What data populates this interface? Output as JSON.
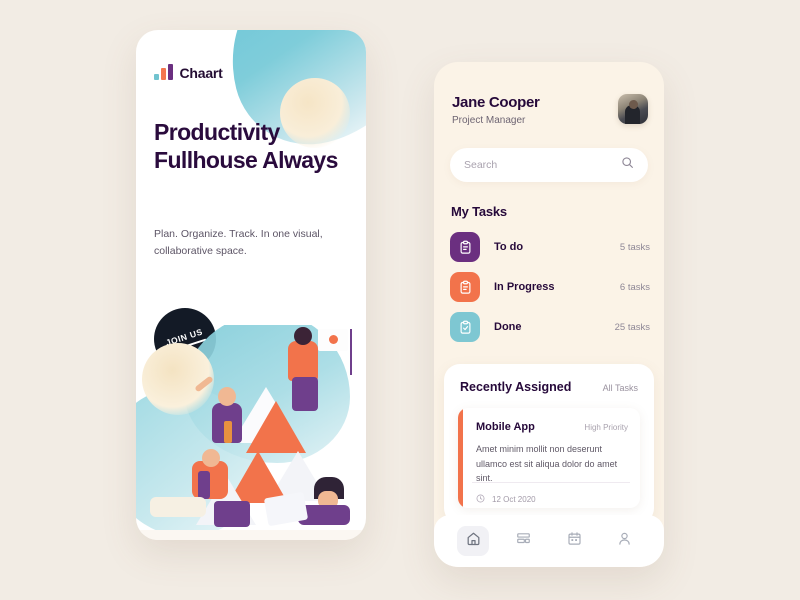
{
  "colors": {
    "background": "#f2ece4",
    "panel": "#fbf3e7",
    "heading": "#2a0b3d",
    "accent_orange": "#f2734b",
    "accent_purple": "#6b2f80",
    "accent_teal": "#7ec7d2",
    "badge_dark": "#131a26"
  },
  "left_card": {
    "logo": {
      "name": "Chaart",
      "bars": [
        "teal",
        "orange",
        "purple"
      ]
    },
    "hero": {
      "title": "Productivity Fullhouse Always",
      "subtitle": "Plan. Organize. Track. In one visual, collaborative space."
    },
    "cta": {
      "label": "JOIN US"
    }
  },
  "right_card": {
    "user": {
      "name": "Jane Cooper",
      "role": "Project Manager",
      "avatar_icon": "user-avatar-photo"
    },
    "search": {
      "placeholder": "Search",
      "value": "",
      "icon": "search-icon"
    },
    "my_tasks": {
      "title": "My Tasks",
      "items": [
        {
          "label": "To do",
          "count": "5 tasks",
          "color": "#6b2f80",
          "icon": "clipboard-icon"
        },
        {
          "label": "In Progress",
          "count": "6 tasks",
          "color": "#f2734b",
          "icon": "clipboard-icon"
        },
        {
          "label": "Done",
          "count": "25 tasks",
          "color": "#7ec7d2",
          "icon": "clipboard-check-icon"
        }
      ]
    },
    "recently_assigned": {
      "title": "Recently Assigned",
      "all_link": "All Tasks",
      "card": {
        "title": "Mobile App",
        "priority": "High Priority",
        "description": "Amet minim mollit non deserunt ullamco est sit aliqua dolor do amet sint.",
        "date": "12 Oct 2020",
        "date_icon": "clock-icon",
        "accent_color": "#f2734b"
      }
    },
    "bottom_nav": {
      "items": [
        {
          "name": "home",
          "icon": "home-icon",
          "active": true
        },
        {
          "name": "board",
          "icon": "board-icon",
          "active": false
        },
        {
          "name": "calendar",
          "icon": "calendar-icon",
          "active": false
        },
        {
          "name": "profile",
          "icon": "person-icon",
          "active": false
        }
      ]
    }
  }
}
